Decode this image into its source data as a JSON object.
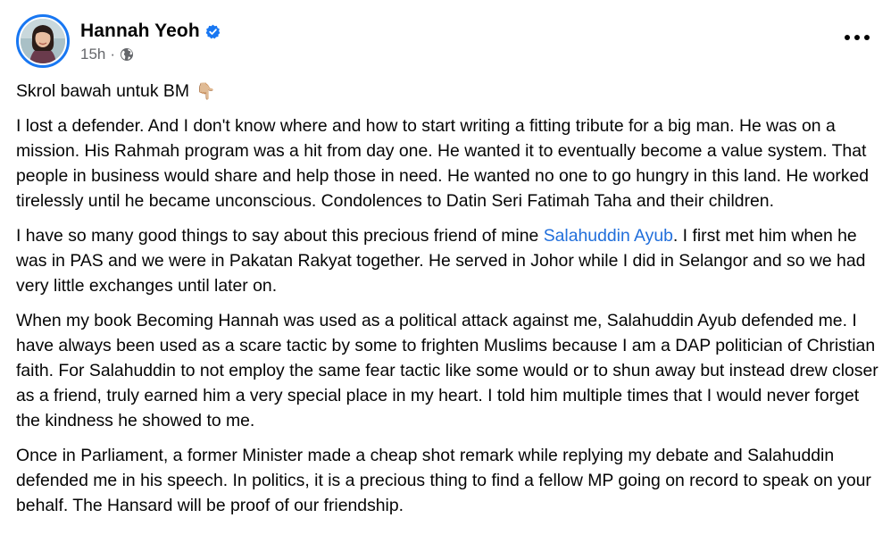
{
  "post": {
    "author": "Hannah Yeoh",
    "timestamp": "15h",
    "separator": "·",
    "intro": "Skrol bawah untuk BM",
    "intro_emoji": "👇🏼",
    "p1": "I lost a defender. And I don't know where and how to start writing a fitting tribute for a big man. He was on a mission. His Rahmah program was a hit from day one. He wanted it to eventually become a value system. That people in business would share and help those in need. He wanted no one to go hungry in this land. He worked tirelessly until he became unconscious. Condolences to Datin Seri Fatimah Taha and their children.",
    "p2_before": "I have so many good things to say about this precious friend of mine ",
    "p2_link": "Salahuddin Ayub",
    "p2_after": ". I first met him when he was in PAS and we were in Pakatan Rakyat together. He served in Johor while I did in Selangor and so we had very little exchanges until later on.",
    "p3": "When my book Becoming Hannah was used as a political attack against me, Salahuddin Ayub defended me. I have always been used as a scare tactic by some to frighten Muslims because I am a DAP politician of Christian faith. For Salahuddin to not employ the same fear tactic like some would or to shun away but instead drew closer as a friend, truly earned him a very special place in my heart. I told him multiple times that I would never forget the kindness he showed to me.",
    "p4": "Once in Parliament, a former Minister made a cheap shot remark while replying my debate and Salahuddin defended me in his speech. In politics, it is a precious thing to find a fellow MP going on record to speak on your behalf. The Hansard will be proof of our friendship."
  },
  "icons": {
    "verified": "verified-badge-icon",
    "audience": "globe-icon",
    "more": "more-options-icon"
  },
  "colors": {
    "link": "#216FDB",
    "verified": "#1877F2",
    "secondary_text": "#65676B",
    "primary_text": "#050505"
  }
}
